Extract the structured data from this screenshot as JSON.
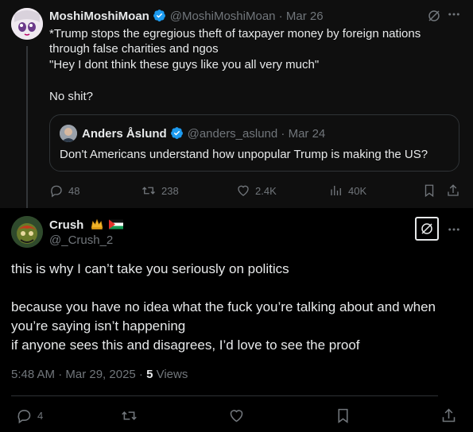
{
  "parent_tweet": {
    "display_name": "MoshiMoshiMoan",
    "handle": "@MoshiMoshiMoan",
    "date": "Mar 26",
    "lines": [
      "*Trump stops the egregious theft of taxpayer money by foreign nations",
      "through false charities and ngos",
      "\"Hey I dont think these guys like you all very much\"",
      "No shit?"
    ],
    "quote": {
      "display_name": "Anders Åslund",
      "handle": "@anders_aslund",
      "date": "Mar 24",
      "text": "Don't Americans understand how unpopular Trump is making the US?"
    },
    "stats": {
      "replies": "48",
      "reposts": "238",
      "likes": "2.4K",
      "views": "40K"
    }
  },
  "main_tweet": {
    "display_name": "Crush",
    "handle": "@_Crush_2",
    "lines": [
      "this is why I can’t take you seriously on politics",
      "because you have no idea what the fuck you’re talking about and when",
      "you’re saying isn’t happening",
      "if anyone sees this and disagrees, I’d love to see the proof"
    ],
    "timestamp": "5:48 AM · Mar 29, 2025 · ",
    "views_count": "5",
    "views_label": " Views",
    "replies": "4"
  },
  "colors": {
    "verified": "#1d9bf0",
    "muted": "#71767b",
    "text": "#e7e9ea"
  }
}
